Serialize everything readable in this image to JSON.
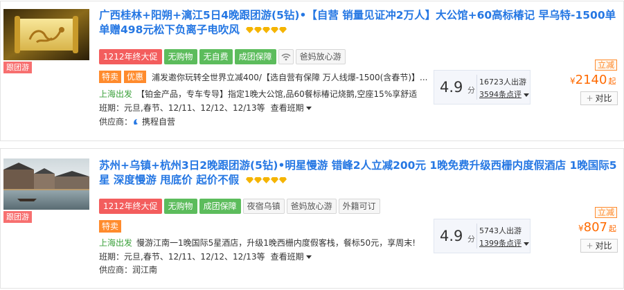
{
  "products": [
    {
      "thumb_tag": "跟团游",
      "title": "广西桂林+阳朔+漓江5日4晚跟团游(5钻)•【自营 销量见证冲2万人】大公馆+60高标椿记 早乌特-1500单单赠498元松下负离子电吹风",
      "diamonds": 5,
      "tags": [
        {
          "label": "1212年终大促",
          "style": "red"
        },
        {
          "label": "无购物",
          "style": "green"
        },
        {
          "label": "无自费",
          "style": "green"
        },
        {
          "label": "成团保障",
          "style": "green"
        },
        {
          "label": "",
          "style": "wifi"
        },
        {
          "label": "爸妈放心游",
          "style": "gray"
        }
      ],
      "promo_badges": [
        "特卖",
        "优惠"
      ],
      "promo_text": "浦发邀你玩转全世界立减400/【选自营有保障 万人线爆-1500(含春节)】...",
      "departure": "上海出发",
      "description": "【铂金产品，专车专导】指定1晚大公馆,品60餐标椿记烧鹅,空座15%享舒适",
      "schedule_label": "班期：",
      "schedule": "元旦,春节、12/11、12/12、12/13等",
      "view_schedule": "查看班期",
      "supplier_label": "供应商：",
      "supplier": "携程自营",
      "score": "4.9",
      "score_unit": "分",
      "travelers": "16723人出游",
      "reviews": "3594条点评",
      "discount_label": "立减",
      "currency": "¥",
      "price": "2140",
      "price_suffix": "起",
      "compare_label": "对比"
    },
    {
      "thumb_tag": "跟团游",
      "title": "苏州+乌镇+杭州3日2晚跟团游(5钻)•明星慢游 错峰2人立减200元 1晚免费升级西栅内度假酒店 1晚国际5星 深度慢游 甩底价 起价不假",
      "diamonds": 5,
      "tags": [
        {
          "label": "1212年终大促",
          "style": "red"
        },
        {
          "label": "无购物",
          "style": "green"
        },
        {
          "label": "成团保障",
          "style": "green"
        },
        {
          "label": "夜宿乌镇",
          "style": "gray"
        },
        {
          "label": "爸妈放心游",
          "style": "gray"
        },
        {
          "label": "外籍可订",
          "style": "gray"
        }
      ],
      "promo_badges": [
        "特卖"
      ],
      "promo_text": "",
      "departure": "上海出发",
      "description": "慢游江南一1晚国际5星酒店，升级1晚西栅内度假客栈，餐标50元，享周末!",
      "schedule_label": "班期：",
      "schedule": "元旦,春节、12/11、12/12、12/13等",
      "view_schedule": "查看班期",
      "supplier_label": "供应商：",
      "supplier": "润江南",
      "score": "4.9",
      "score_unit": "分",
      "travelers": "5743人出游",
      "reviews": "1399条点评",
      "discount_label": "立减",
      "currency": "¥",
      "price": "807",
      "price_suffix": "起",
      "compare_label": "对比"
    }
  ],
  "colors": {
    "title_blue": "#2577e3",
    "price_orange": "#ff6a00",
    "promo_orange": "#ff8b2d",
    "tag_red": "#f35d5d",
    "tag_green": "#5cbc5c",
    "departure_green": "#3aa03a"
  }
}
